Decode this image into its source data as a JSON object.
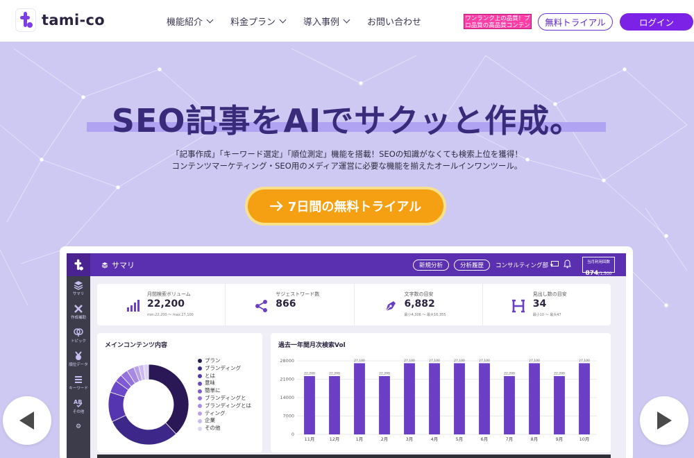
{
  "header": {
    "logo_text": "tami-co",
    "nav": [
      {
        "label": "機能紹介",
        "has_dropdown": true
      },
      {
        "label": "料金プラン",
        "has_dropdown": true
      },
      {
        "label": "導入事例",
        "has_dropdown": true
      },
      {
        "label": "お問い合わせ",
        "has_dropdown": false
      }
    ],
    "promo_text": "ワンランク上の品質！プロ品質の高品質コンテンツ",
    "trial_button": "無料トライアル",
    "login_button": "ログイン"
  },
  "hero": {
    "title": "SEO記事をAIでサクッと作成。",
    "subtitle_line1": "「記事作成」「キーワード選定」「順位測定」機能を搭載！SEOの知識がなくても検索上位を獲得！",
    "subtitle_line2": "コンテンツマーケティング・SEO用のメディア運営に必要な機能を揃えたオールインワンツール。",
    "cta_label": "7日間の無料トライアル"
  },
  "app": {
    "title": "サマリ",
    "btn_new_analysis": "新規分析",
    "btn_history": "分析履歴",
    "team": "コンサルティング部",
    "usage_label": "当月利用回数",
    "usage_value": "874",
    "usage_total": "/1,500",
    "sidebar": [
      "サマリ",
      "作成補助",
      "トピック",
      "順位データ",
      "キーワード",
      "その他"
    ],
    "stats": [
      {
        "label": "月間検索ボリューム",
        "value": "22,200",
        "sub": "min:22,200 〜 max:27,100",
        "icon": "bar-chart-icon"
      },
      {
        "label": "サジェストワード数",
        "value": "866",
        "sub": "",
        "icon": "share-icon"
      },
      {
        "label": "文字数の目安",
        "value": "6,882",
        "sub": "最小4,306 〜 最大16,355",
        "icon": "pen-nib-icon"
      },
      {
        "label": "見出し数の目安",
        "value": "34",
        "sub": "最小10 〜 最大47",
        "icon": "heading-h-icon"
      }
    ],
    "donut_panel_title": "メインコンテンツ内容",
    "bar_panel_title": "過去一年間月次検索Vol",
    "legend": [
      "プラン",
      "ブランディング",
      "とは",
      "意味",
      "簡単に",
      "ブランディングと",
      "ブランディングとは",
      "ティング",
      "企業",
      "その他"
    ],
    "colors": {
      "primary": "#5a2fb0",
      "accent_bar": "#6a3fc6",
      "cta": "#f4a012",
      "hero_bg": "#cdc9f2",
      "login": "#7b22e6"
    }
  },
  "chart_data": [
    {
      "type": "pie",
      "title": "メインコンテンツ内容",
      "categories": [
        "プラン",
        "ブランディング",
        "とは",
        "意味",
        "簡単に",
        "ブランディングと",
        "ブランディングとは",
        "ティング",
        "企業",
        "その他"
      ],
      "values": [
        38,
        30,
        12,
        5,
        3,
        3,
        3,
        2,
        2,
        2
      ],
      "colors": [
        "#2a1856",
        "#3d2788",
        "#5535b0",
        "#6c49c8",
        "#7f5ad4",
        "#9372dc",
        "#a78ae3",
        "#b9a1ea",
        "#cbb9f0",
        "#ddd2f6"
      ],
      "donut": true
    },
    {
      "type": "bar",
      "title": "過去一年間月次検索Vol",
      "categories": [
        "11月",
        "12月",
        "1月",
        "2月",
        "3月",
        "4月",
        "5月",
        "6月",
        "7月",
        "8月",
        "9月",
        "10月"
      ],
      "values": [
        22200,
        22200,
        27100,
        22200,
        27100,
        27100,
        27100,
        27100,
        22200,
        27100,
        22200,
        27100
      ],
      "data_labels": [
        "22,200",
        "22,200",
        "27,100",
        "22,200",
        "27,100",
        "27,100",
        "27,100",
        "27,100",
        "22,200",
        "27,100",
        "22,200",
        "27,100"
      ],
      "y_ticks": [
        "0",
        "7000",
        "14000",
        "21000",
        "28000"
      ],
      "ylim": [
        0,
        28000
      ],
      "grid": true
    }
  ]
}
